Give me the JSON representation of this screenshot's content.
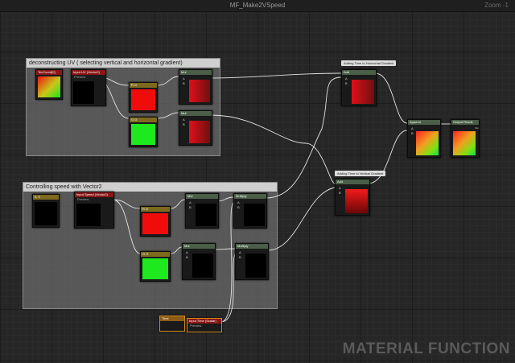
{
  "window": {
    "title": "MF_Make2VSpeed",
    "zoom": "Zoom -1"
  },
  "comments": [
    {
      "id": "c1",
      "label": "deconstructing UV ( selecting vertical and horizontal gradient)"
    },
    {
      "id": "c2",
      "label": "Controlling speed with Vector2"
    }
  ],
  "nodes": {
    "texcoord": {
      "title": "TexCoord[0]"
    },
    "input_uv": {
      "title": "Input UV (Vector2)",
      "sub": "Preview"
    },
    "mask_r1": {
      "title": "R G"
    },
    "mask_g1": {
      "title": "G G"
    },
    "mul1": {
      "title": "Mul",
      "a": "A",
      "b": "B"
    },
    "mul2": {
      "title": "Mul",
      "a": "A",
      "b": "B"
    },
    "add_top": {
      "title": "Add",
      "a": "A",
      "b": "B"
    },
    "add_bot": {
      "title": "Add",
      "a": "A",
      "b": "B"
    },
    "append": {
      "title": "Append",
      "a": "A",
      "b": "B"
    },
    "output": {
      "title": "Output Result",
      "pin": "Out"
    },
    "const_2": {
      "title": "0, 0"
    },
    "input_speed": {
      "title": "Input Speed (Vector2)",
      "sub": "Preview"
    },
    "mask_r2": {
      "title": "R G"
    },
    "mask_g2": {
      "title": "G G"
    },
    "sub_mul1": {
      "title": "Mul",
      "a": "A",
      "b": "B"
    },
    "sub_mul2": {
      "title": "Mul",
      "a": "A",
      "b": "B"
    },
    "multiply1": {
      "title": "Multiply",
      "a": "A",
      "b": "B"
    },
    "multiply2": {
      "title": "Multiply",
      "a": "A",
      "b": "B"
    },
    "time": {
      "title": "Time"
    },
    "input_time": {
      "title": "Input Time (Scalar)",
      "sub": "Preview"
    }
  },
  "tags": {
    "horizontal": "Adding Time to Horizontal Gradient",
    "vertical": "Adding Time to Vertical Gradient"
  },
  "watermark": "MATERIAL FUNCTION",
  "colors": {
    "background": "#262626",
    "header_green": "#3a6e3a",
    "header_red": "#8a1616",
    "header_olive": "#7d6a1f",
    "header_orange": "#8c5a14",
    "wire": "#e8e8e8"
  }
}
